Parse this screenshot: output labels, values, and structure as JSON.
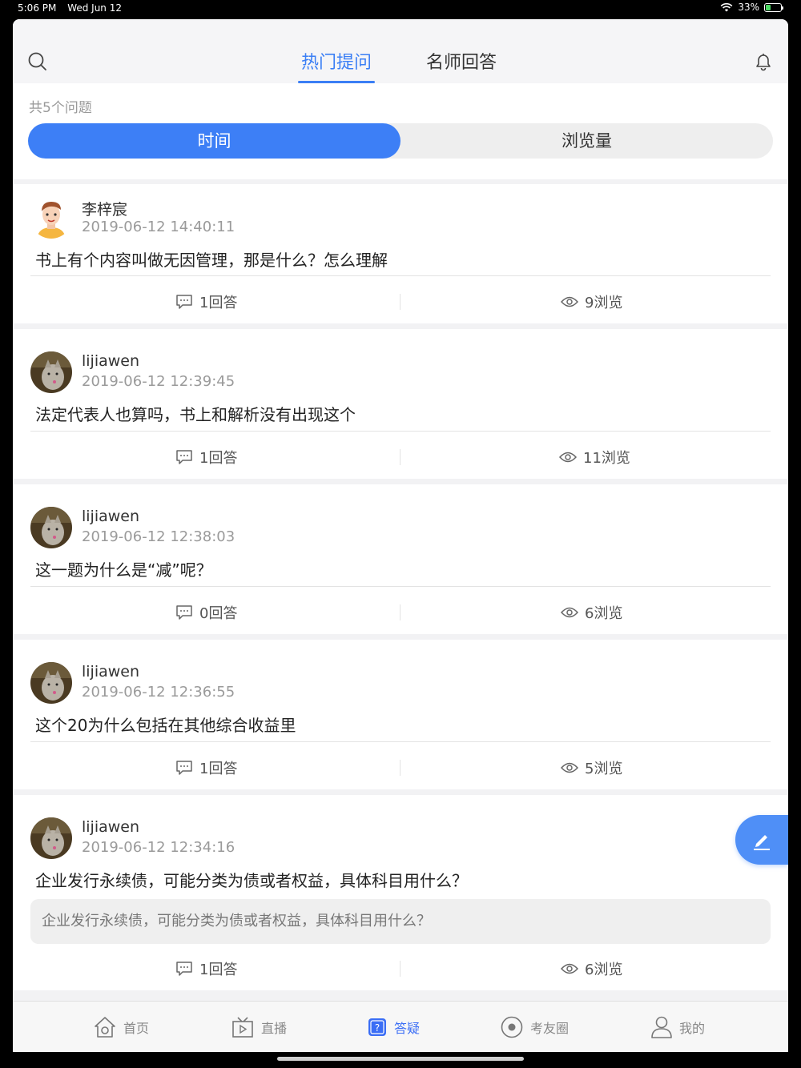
{
  "status": {
    "time": "5:06 PM",
    "date": "Wed Jun 12",
    "battery": "33%",
    "battery_level": 0.33
  },
  "header": {
    "tabs": [
      {
        "label": "热门提问",
        "active": true
      },
      {
        "label": "名师回答",
        "active": false
      }
    ],
    "search_icon": "search-icon",
    "bell_icon": "bell-icon"
  },
  "list": {
    "count_label": "共5个问题",
    "sort": [
      {
        "label": "时间",
        "active": true
      },
      {
        "label": "浏览量",
        "active": false
      }
    ]
  },
  "questions": [
    {
      "user": "李梓宸",
      "time": "2019-06-12 14:40:11",
      "question": "书上有个内容叫做无因管理，那是什么？怎么理解",
      "answers": "1回答",
      "views": "9浏览",
      "avatar": "cartoon-boy"
    },
    {
      "user": "lijiawen",
      "time": "2019-06-12 12:39:45",
      "question": "法定代表人也算吗，书上和解析没有出现这个",
      "answers": "1回答",
      "views": "11浏览",
      "avatar": "cat-photo"
    },
    {
      "user": "lijiawen",
      "time": "2019-06-12 12:38:03",
      "question": "这一题为什么是“减”呢？",
      "answers": "0回答",
      "views": "6浏览",
      "avatar": "cat-photo"
    },
    {
      "user": "lijiawen",
      "time": "2019-06-12 12:36:55",
      "question": "这个20为什么包括在其他综合收益里",
      "answers": "1回答",
      "views": "5浏览",
      "avatar": "cat-photo"
    },
    {
      "user": "lijiawen",
      "time": "2019-06-12 12:34:16",
      "question": "企业发行永续债，可能分类为债或者权益，具体科目用什么？",
      "excerpt": "企业发行永续债，可能分类为债或者权益，具体科目用什么？",
      "answers": "1回答",
      "views": "6浏览",
      "avatar": "cat-photo"
    }
  ],
  "fab": {
    "icon": "pencil-icon"
  },
  "tabbar": [
    {
      "label": "首页",
      "icon": "home-icon",
      "active": false
    },
    {
      "label": "直播",
      "icon": "tv-icon",
      "active": false
    },
    {
      "label": "答疑",
      "icon": "question-icon",
      "active": true
    },
    {
      "label": "考友圈",
      "icon": "circle-icon",
      "active": false
    },
    {
      "label": "我的",
      "icon": "user-icon",
      "active": false
    }
  ],
  "colors": {
    "accent": "#3d7ff6",
    "background": "#f2f2f4"
  }
}
